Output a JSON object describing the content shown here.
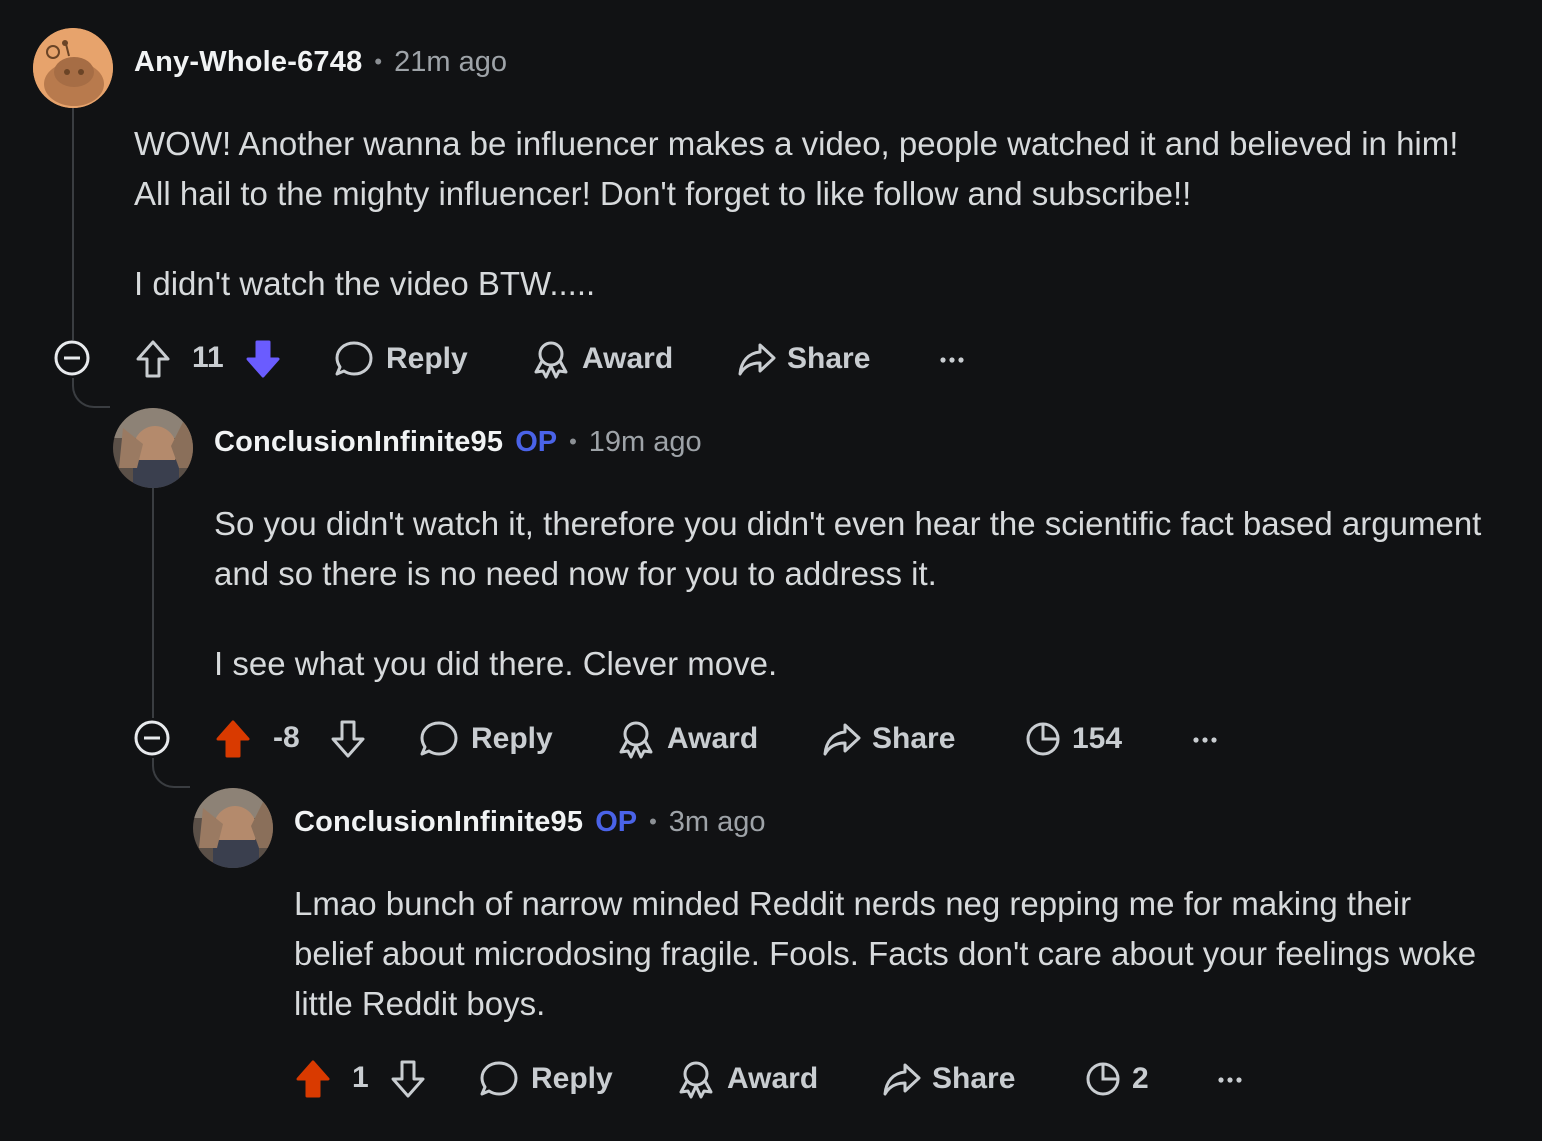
{
  "colors": {
    "background": "#111214",
    "op_badge": "#4a63e8",
    "downvote_active": "#6a5cff",
    "upvote_active": "#d93a00",
    "thread_line": "#3a3d41"
  },
  "comments": [
    {
      "username": "Any-Whole-6748",
      "op_badge": "",
      "time": "21m ago",
      "paragraphs": [
        "WOW! Another wanna be influencer makes a video, people watched it and believed in him! All hail to the mighty influencer! Don't forget to like follow and subscribe!!",
        "I didn't watch the video BTW....."
      ],
      "score": "11",
      "vote_state": "downvoted",
      "reply_label": "Reply",
      "award_label": "Award",
      "share_label": "Share",
      "views": "",
      "more_icon": "ellipsis-icon"
    },
    {
      "username": "ConclusionInfinite95",
      "op_badge": "OP",
      "time": "19m ago",
      "paragraphs": [
        "So you didn't watch it, therefore you didn't even hear the scientific fact based argument and so there is no need now for you to address it.",
        "I see what you did there. Clever move."
      ],
      "score": "-8",
      "vote_state": "upvoted",
      "reply_label": "Reply",
      "award_label": "Award",
      "share_label": "Share",
      "views": "154",
      "more_icon": "ellipsis-icon"
    },
    {
      "username": "ConclusionInfinite95",
      "op_badge": "OP",
      "time": "3m ago",
      "paragraphs": [
        "Lmao bunch of narrow minded Reddit nerds neg repping me for making their belief about microdosing fragile. Fools. Facts don't care about your feelings woke little Reddit boys."
      ],
      "score": "1",
      "vote_state": "upvoted",
      "reply_label": "Reply",
      "award_label": "Award",
      "share_label": "Share",
      "views": "2",
      "more_icon": "ellipsis-icon"
    }
  ]
}
